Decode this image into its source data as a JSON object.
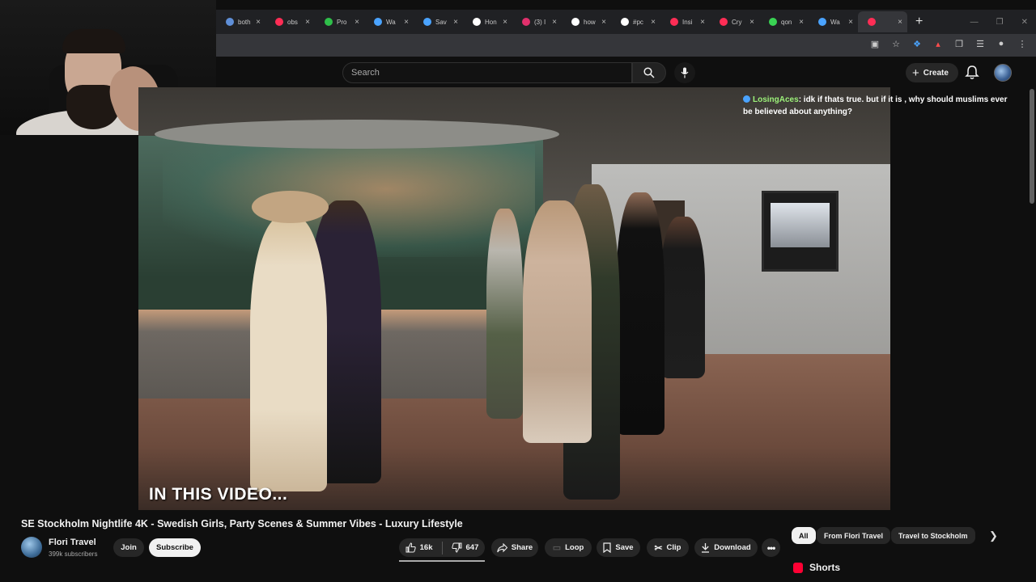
{
  "browser": {
    "tabs": [
      {
        "label": "both",
        "color": "#5f8fd8"
      },
      {
        "label": "obs",
        "color": "#ff2d55"
      },
      {
        "label": "Pro",
        "color": "#2fbf4a"
      },
      {
        "label": "Wa",
        "color": "#4aa3ff"
      },
      {
        "label": "Sav",
        "color": "#4aa3ff"
      },
      {
        "label": "Hon",
        "color": "#ffffff"
      },
      {
        "label": "(3) I",
        "color": "#e1306c"
      },
      {
        "label": "how",
        "color": "#ffffff"
      },
      {
        "label": "#pc",
        "color": "#ffffff"
      },
      {
        "label": "Insi",
        "color": "#ff2d55"
      },
      {
        "label": "Cry",
        "color": "#ff2d55"
      },
      {
        "label": "qon",
        "color": "#39d353"
      },
      {
        "label": "Wa",
        "color": "#4aa3ff"
      },
      {
        "label": "",
        "color": "#ff2d55"
      }
    ],
    "new_tab_symbol": "+"
  },
  "header": {
    "search_placeholder": "Search",
    "create_label": "Create"
  },
  "video": {
    "caption": "IN THIS VIDEO..."
  },
  "chat": {
    "username": "LosingAces",
    "message": ": idk if thats true. but if it is , why should muslims ever be believed about anything?"
  },
  "watch": {
    "title": "SE Stockholm Nightlife 4K - Swedish Girls, Party Scenes & Summer Vibes - Luxury Lifestyle",
    "channel_name": "Flori Travel",
    "subscribers": "399k subscribers",
    "join_label": "Join",
    "subscribe_label": "Subscribe",
    "likes": "16k",
    "dislikes": "647",
    "share_label": "Share",
    "loop_label": "Loop",
    "save_label": "Save",
    "clip_label": "Clip",
    "download_label": "Download"
  },
  "chips": {
    "all": "All",
    "from_channel": "From Flori Travel",
    "travel": "Travel to Stockholm"
  },
  "shorts_label": "Shorts",
  "colors": {
    "background": "#0f0f0f",
    "accent_red": "#ff0033",
    "chat_username": "#9cf27a"
  }
}
